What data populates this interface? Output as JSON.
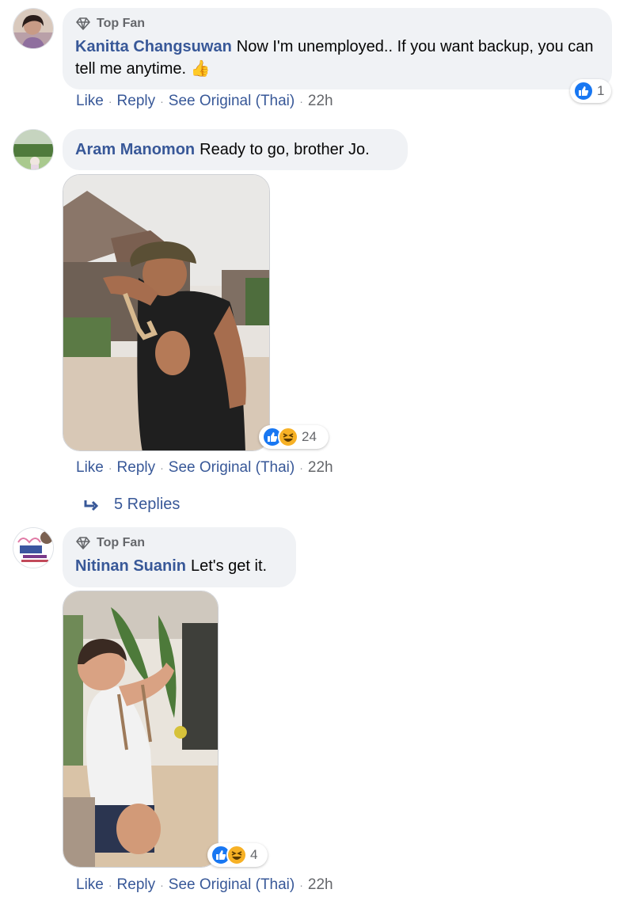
{
  "colors": {
    "link": "#385898",
    "bubble": "#f0f2f5",
    "meta": "#65676b",
    "like_blue": "#1877f2",
    "haha_yellow": "#f7b125"
  },
  "comments": [
    {
      "badge": "Top Fan",
      "author": "Kanitta Changsuwan",
      "text": "Now I'm unemployed.. If you want backup, you can tell me anytime.",
      "emoji": "👍",
      "reactions": {
        "icons": [
          "like-icon"
        ],
        "count": "1"
      },
      "actions": {
        "like": "Like",
        "reply": "Reply",
        "see_original": "See Original (Thai)",
        "time": "22h"
      }
    },
    {
      "author": "Aram Manomon",
      "text": "Ready to go, brother Jo.",
      "reactions": {
        "icons": [
          "like-icon",
          "haha-icon"
        ],
        "count": "24"
      },
      "actions": {
        "like": "Like",
        "reply": "Reply",
        "see_original": "See Original (Thai)",
        "time": "22h"
      },
      "replies": {
        "icon": "reply-arrow-icon",
        "label": "5 Replies"
      }
    },
    {
      "badge": "Top Fan",
      "author": "Nitinan Suanin",
      "text": "Let's get it.",
      "reactions": {
        "icons": [
          "like-icon",
          "haha-icon"
        ],
        "count": "4"
      },
      "actions": {
        "like": "Like",
        "reply": "Reply",
        "see_original": "See Original (Thai)",
        "time": "22h"
      }
    }
  ]
}
